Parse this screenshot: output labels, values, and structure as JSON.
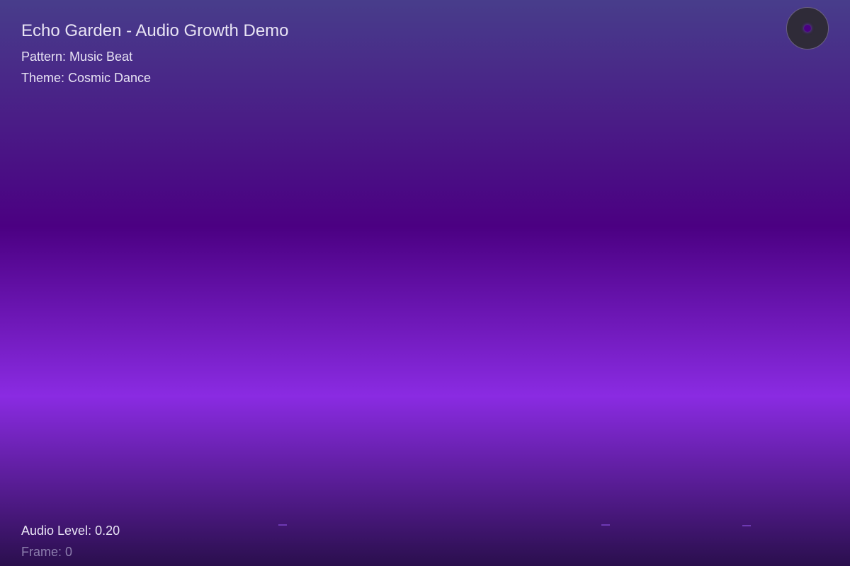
{
  "app": {
    "title": "Echo Garden - Audio Growth Demo"
  },
  "status": {
    "pattern_text": "Pattern: Music Beat",
    "theme_text": "Theme: Cosmic Dance",
    "audio_level_text": "Audio Level: 0.20",
    "frame_text": "Frame: 0"
  },
  "indicator": {
    "icon": "mic-level-icon"
  },
  "colors": {
    "sky_top": "#483d8b",
    "sky_mid": "#4b0082",
    "sky_glow": "#8a2be2",
    "ground": "#2a0f4d",
    "seed": "#9b5cf6"
  }
}
